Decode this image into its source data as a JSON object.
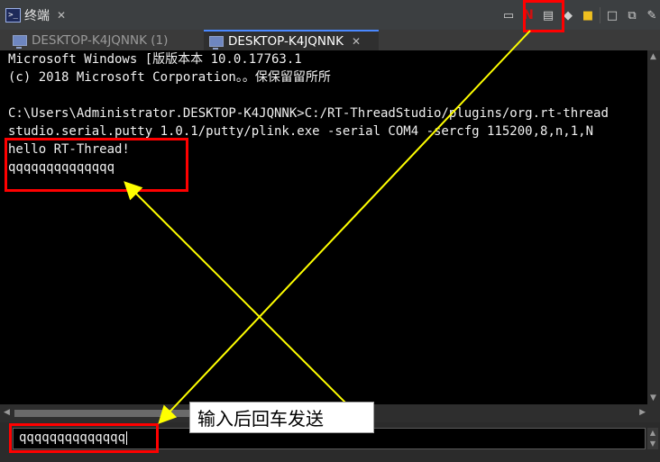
{
  "view": {
    "title": "终端",
    "close_glyph": "✕",
    "icons": [
      "terminal-icon",
      "monitor-icon",
      "disconnect-icon",
      "scroll-lock-icon",
      "clear-icon",
      "lock-icon",
      "new-console-icon",
      "copy-icon",
      "pin-icon"
    ]
  },
  "tabs": [
    {
      "label": "DESKTOP-K4JQNNK (1)",
      "active": false
    },
    {
      "label": "DESKTOP-K4JQNNK",
      "active": true
    }
  ],
  "console": {
    "lines": [
      "Microsoft Windows [版版本本 10.0.17763.1",
      "(c) 2018 Microsoft Corporation。。保保留留所所",
      "",
      "C:\\Users\\Administrator.DESKTOP-K4JQNNK>C:/RT-ThreadStudio/plugins/org.rt-thread",
      "studio.serial.putty_1.0.1/putty/plink.exe -serial COM4 -sercfg 115200,8,n,1,N",
      "hello RT-Thread!",
      "qqqqqqqqqqqqqq"
    ]
  },
  "input": {
    "value": "qqqqqqqqqqqqqq"
  },
  "annotation": {
    "label": "输入后回车发送",
    "highlight_color": "#ff0000",
    "arrow_color": "#ffff00"
  }
}
